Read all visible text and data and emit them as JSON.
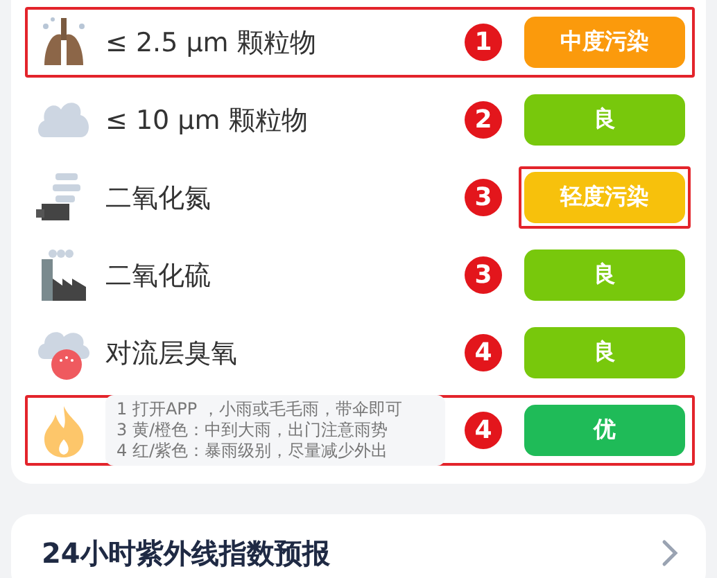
{
  "rows": [
    {
      "kind": "pollutant",
      "name": "≤ 2.5 μm 颗粒物",
      "number": "1",
      "badge": "中度污染",
      "color": "#fb9a0c",
      "highlighted": true,
      "badge_highlighted": false
    },
    {
      "kind": "pollutant",
      "name": "≤ 10 μm 颗粒物",
      "number": "2",
      "badge": "良",
      "color": "#78c80c",
      "highlighted": false,
      "badge_highlighted": false
    },
    {
      "kind": "pollutant",
      "name": "二氧化氮",
      "number": "3",
      "badge": "轻度污染",
      "color": "#f7c10c",
      "highlighted": false,
      "badge_highlighted": true
    },
    {
      "kind": "pollutant",
      "name": "二氧化硫",
      "number": "3",
      "badge": "良",
      "color": "#78c80c",
      "highlighted": false,
      "badge_highlighted": false
    },
    {
      "kind": "pollutant",
      "name": "对流层臭氧",
      "number": "4",
      "badge": "良",
      "color": "#78c80c",
      "highlighted": false,
      "badge_highlighted": false
    },
    {
      "kind": "note",
      "lines": [
        "1 打开APP ，小雨或毛毛雨，带伞即可",
        "3 黄/橙色：中到大雨，出门注意雨势",
        "4 红/紫色：暴雨级别，尽量减少外出"
      ],
      "number": "4",
      "badge": "优",
      "color": "#1fbb58",
      "highlighted": true,
      "badge_highlighted": false
    }
  ],
  "forecast": {
    "title": "24小时紫外线指数预报"
  }
}
